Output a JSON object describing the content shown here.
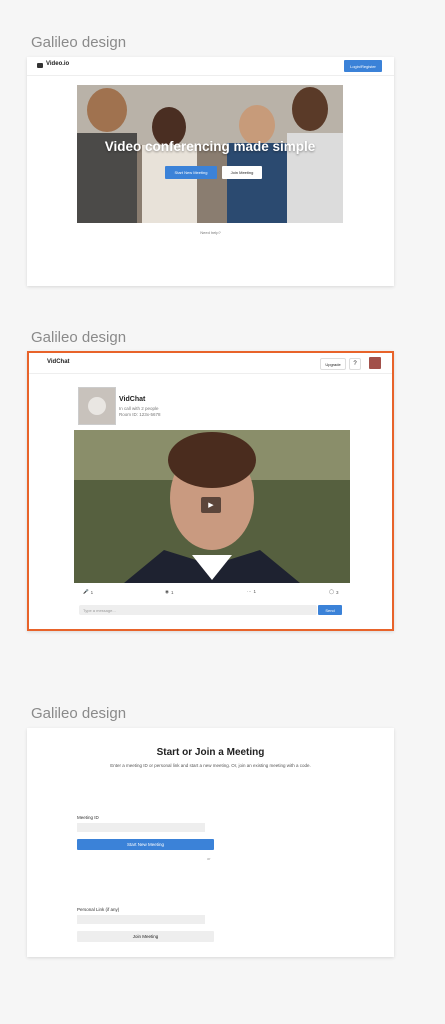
{
  "sections": [
    {
      "label": "Galileo design"
    },
    {
      "label": "Galileo design"
    },
    {
      "label": "Galileo design"
    }
  ],
  "landing": {
    "logo": "Video.io",
    "login_label": "Login/Register",
    "hero_title": "Video conferencing made simple",
    "start_label": "Start New Meeting",
    "join_label": "Join Meeting",
    "help_text": "Need help?"
  },
  "call": {
    "brand": "VidChat",
    "upgrade_label": "Upgrade",
    "help_symbol": "?",
    "title": "VidChat",
    "subtitle": "In call with 2 people",
    "room": "Room ID: 123x-5678",
    "controls": {
      "mic_count": "1",
      "camera_count": "1",
      "more_count": "1",
      "chat_count": "3"
    },
    "message_placeholder": "Type a message...",
    "send_label": "Send"
  },
  "join": {
    "title": "Start or Join a Meeting",
    "description": "Enter a meeting ID or personal link and start a new meeting. Or, join an existing meeting with a code.",
    "meeting_id_label": "Meeting ID",
    "start_label": "Start New Meeting",
    "or_text": "or",
    "personal_link_label": "Personal Link (if any)",
    "join_label": "Join Meeting"
  },
  "colors": {
    "accent": "#3b82d8",
    "highlight_border": "#e8632a"
  }
}
